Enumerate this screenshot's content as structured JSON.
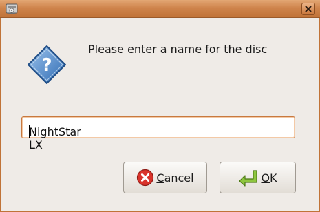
{
  "window": {
    "title": ""
  },
  "dialog": {
    "prompt": "Please enter a name for the disc",
    "name_value": "NightStar LX",
    "cancel_label_mnemonic": "C",
    "cancel_label_rest": "ancel",
    "ok_label_mnemonic": "O",
    "ok_label_rest": "K"
  },
  "icons": {
    "app": "disc-burner-icon",
    "close": "close-icon",
    "question": "question-icon",
    "cancel": "cancel-icon",
    "ok": "enter-arrow-icon"
  },
  "colors": {
    "titlebar": "#cf844c",
    "focus_border": "#c8793f",
    "window_bg": "#efebe7"
  }
}
